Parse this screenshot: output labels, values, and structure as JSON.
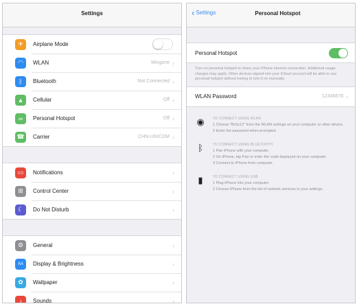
{
  "settings": {
    "title": "Settings",
    "group1": [
      {
        "label": "Airplane Mode",
        "icon": "airplane-icon",
        "color": "#f39c28",
        "kind": "toggle",
        "value": ""
      },
      {
        "label": "WLAN",
        "icon": "wifi-icon",
        "color": "#2e8cf0",
        "kind": "value",
        "value": "Mingone"
      },
      {
        "label": "Bluetooth",
        "icon": "bluetooth-icon",
        "color": "#2e8cf0",
        "kind": "value",
        "value": "Not Connected"
      },
      {
        "label": "Cellular",
        "icon": "cellular-icon",
        "color": "#5fbd64",
        "kind": "value",
        "value": "Off"
      },
      {
        "label": "Personal Hotspot",
        "icon": "hotspot-icon",
        "color": "#5fbd64",
        "kind": "value",
        "value": "Off"
      },
      {
        "label": "Carrier",
        "icon": "phone-icon",
        "color": "#5fbd64",
        "kind": "value",
        "value": "CHN-UNICOM"
      }
    ],
    "group2": [
      {
        "label": "Notifications",
        "icon": "notifications-icon",
        "color": "#e8483c",
        "value": ""
      },
      {
        "label": "Control Center",
        "icon": "control-center-icon",
        "color": "#8e8e93",
        "value": ""
      },
      {
        "label": "Do Not Disturb",
        "icon": "moon-icon",
        "color": "#5a5cd0",
        "value": ""
      }
    ],
    "group3": [
      {
        "label": "General",
        "icon": "gear-icon",
        "color": "#8e8e93",
        "value": ""
      },
      {
        "label": "Display & Brightness",
        "icon": "display-icon",
        "color": "#2e8cf0",
        "value": ""
      },
      {
        "label": "Wallpaper",
        "icon": "wallpaper-icon",
        "color": "#37a9e4",
        "value": ""
      },
      {
        "label": "Sounds",
        "icon": "sounds-icon",
        "color": "#e8483c",
        "value": ""
      }
    ]
  },
  "hotspot": {
    "back_label": "Settings",
    "title": "Personal Hotspot",
    "toggle_label": "Personal Hotspot",
    "toggle_on": true,
    "description": "Turn on personal hotspot to share your iPhone internet connection. Additional usage charges may apply. Other devices signed into your iCloud account will be able to use personal hotspot without having to turn it on manually.",
    "password_label": "WLAN Password",
    "password_value": "12345678",
    "instructions": [
      {
        "icon": "wifi-icon",
        "heading": "TO CONNECT USING WLAN",
        "steps": [
          "1 Choose \"BrSz12\" from the WLAN settings on your computer or other device.",
          "2 Enter the password when prompted."
        ]
      },
      {
        "icon": "bluetooth-icon",
        "heading": "TO CONNECT USING BLUETOOTH",
        "steps": [
          "1 Pair iPhone with your computer.",
          "2 On iPhone, tap Pair or enter the code displayed on your computer.",
          "3 Connect to iPhone from computer."
        ]
      },
      {
        "icon": "usb-icon",
        "heading": "TO CONNECT USING USB",
        "steps": [
          "1 Plug iPhone into your computer.",
          "2 Choose iPhone from the list of network services in your settings."
        ]
      }
    ]
  }
}
